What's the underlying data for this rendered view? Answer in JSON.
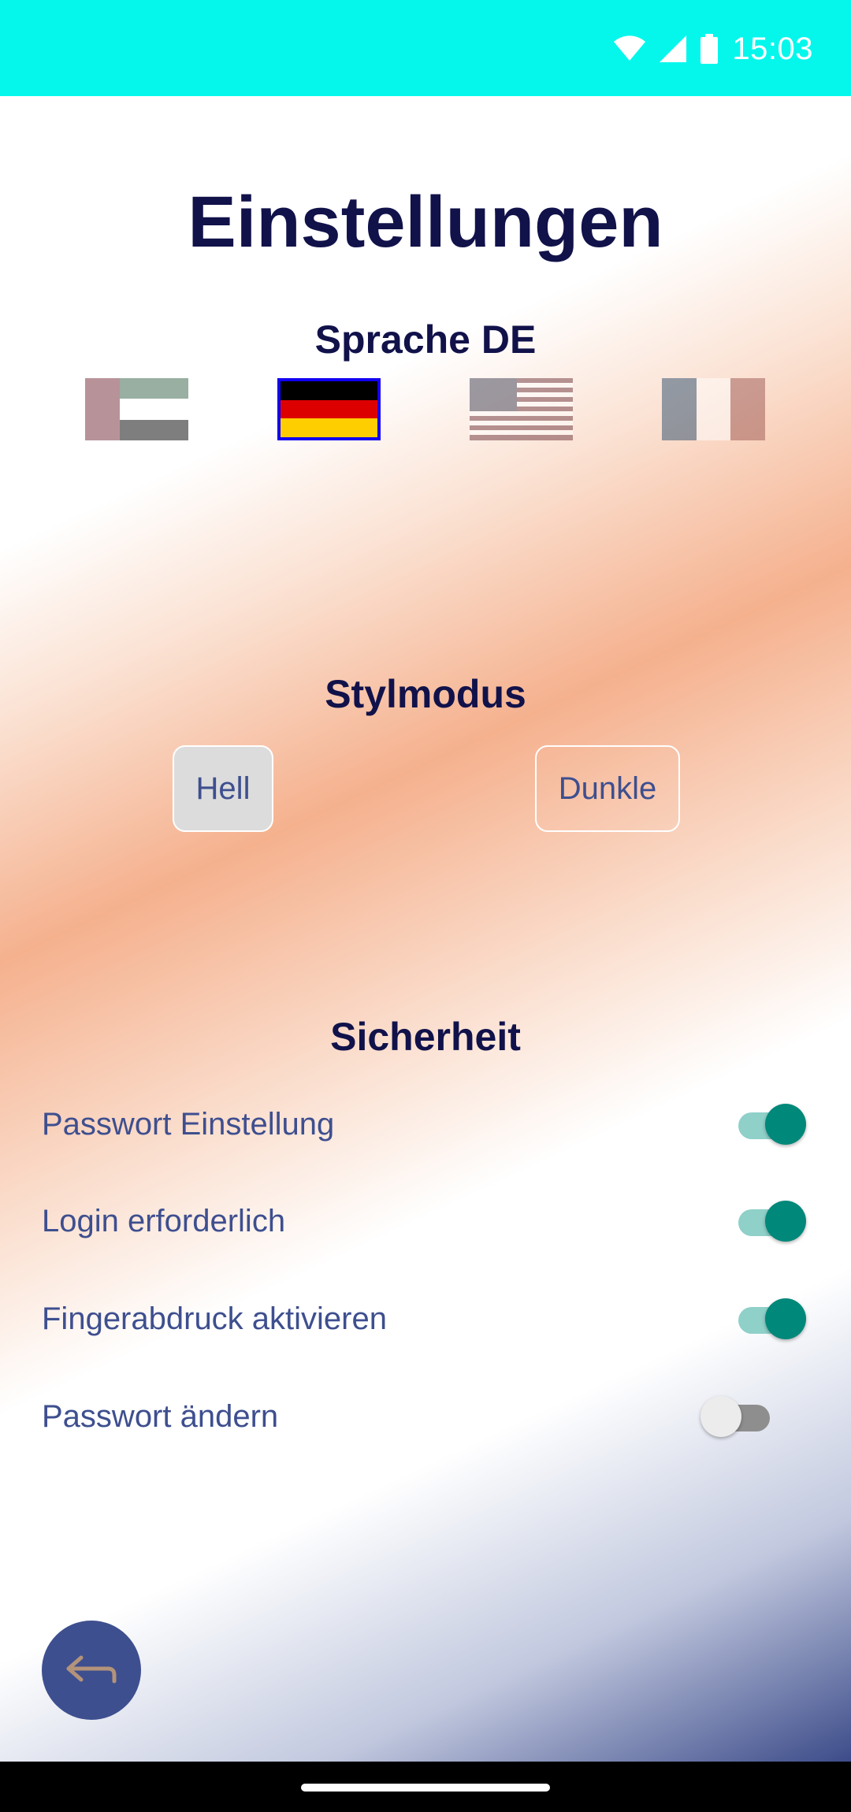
{
  "status_bar": {
    "time": "15:03",
    "background": "#05f7ec"
  },
  "page": {
    "title": "Einstellungen"
  },
  "language": {
    "label": "Sprache  DE",
    "selected": "DE",
    "flags": [
      {
        "code": "AE",
        "icon": "uae-flag-icon",
        "selected": false
      },
      {
        "code": "DE",
        "icon": "germany-flag-icon",
        "selected": true
      },
      {
        "code": "US",
        "icon": "usa-flag-icon",
        "selected": false
      },
      {
        "code": "FR",
        "icon": "france-flag-icon",
        "selected": false
      }
    ]
  },
  "style_mode": {
    "label": "Stylmodus",
    "light_label": "Hell",
    "dark_label": "Dunkle",
    "selected": "Hell"
  },
  "security": {
    "label": "Sicherheit",
    "items": [
      {
        "label": "Passwort Einstellung",
        "enabled": true
      },
      {
        "label": "Login erforderlich",
        "enabled": true
      },
      {
        "label": "Fingerabdruck aktivieren",
        "enabled": true
      },
      {
        "label": "Passwort ändern",
        "enabled": false
      }
    ]
  },
  "back_button": {
    "icon": "back-arrow-icon"
  },
  "colors": {
    "title": "#11124a",
    "text": "#3e4f8f",
    "switch_on": "#00887a",
    "selection_border": "#1200f0"
  }
}
